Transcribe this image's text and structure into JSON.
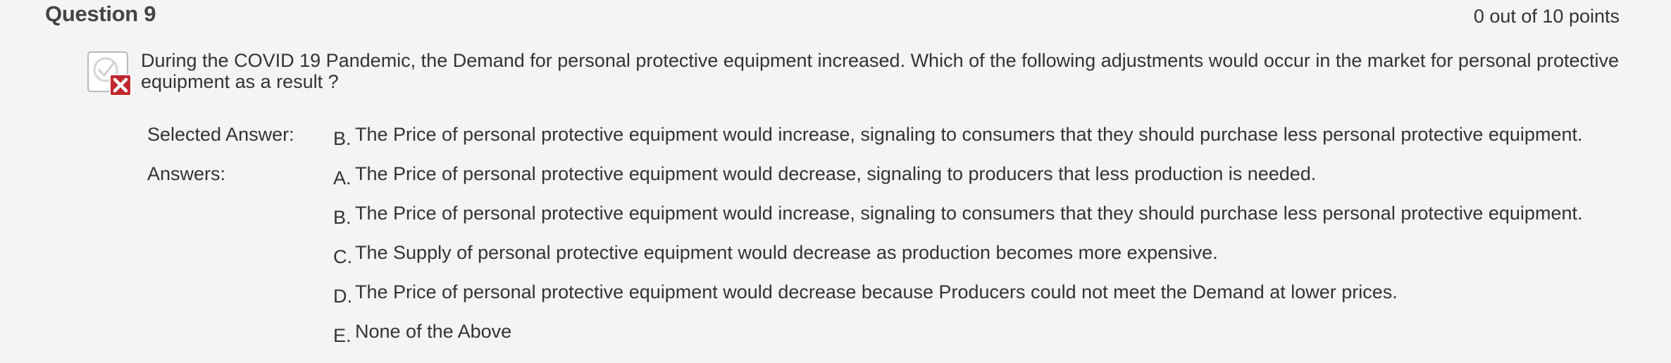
{
  "question": {
    "title": "Question 9",
    "points": "0 out of 10 points",
    "status_icon": "incorrect-icon",
    "text": "During the COVID 19 Pandemic, the Demand for personal protective equipment increased. Which of the following adjustments would occur in the market for personal protective equipment as a result ?"
  },
  "selected": {
    "label": "Selected Answer:",
    "letter": "B.",
    "text": "The Price of personal protective equipment would increase, signaling to consumers that they should purchase less personal protective equipment."
  },
  "answers": {
    "label": "Answers:",
    "items": [
      {
        "letter": "A.",
        "text": "The Price of personal protective equipment would decrease, signaling to producers that less production is needed."
      },
      {
        "letter": "B.",
        "text": "The Price of personal protective equipment would increase, signaling to consumers that they should purchase less personal protective equipment."
      },
      {
        "letter": "C.",
        "text": "The Supply of personal protective equipment would decrease as production becomes more expensive."
      },
      {
        "letter": "D.",
        "text": "The Price of personal protective equipment would decrease because Producers could not meet the Demand at lower prices."
      },
      {
        "letter": "E.",
        "text": "None of the Above"
      }
    ]
  },
  "colors": {
    "background": "#f4f4f4",
    "text": "#333333",
    "incorrect": "#c0272d"
  }
}
